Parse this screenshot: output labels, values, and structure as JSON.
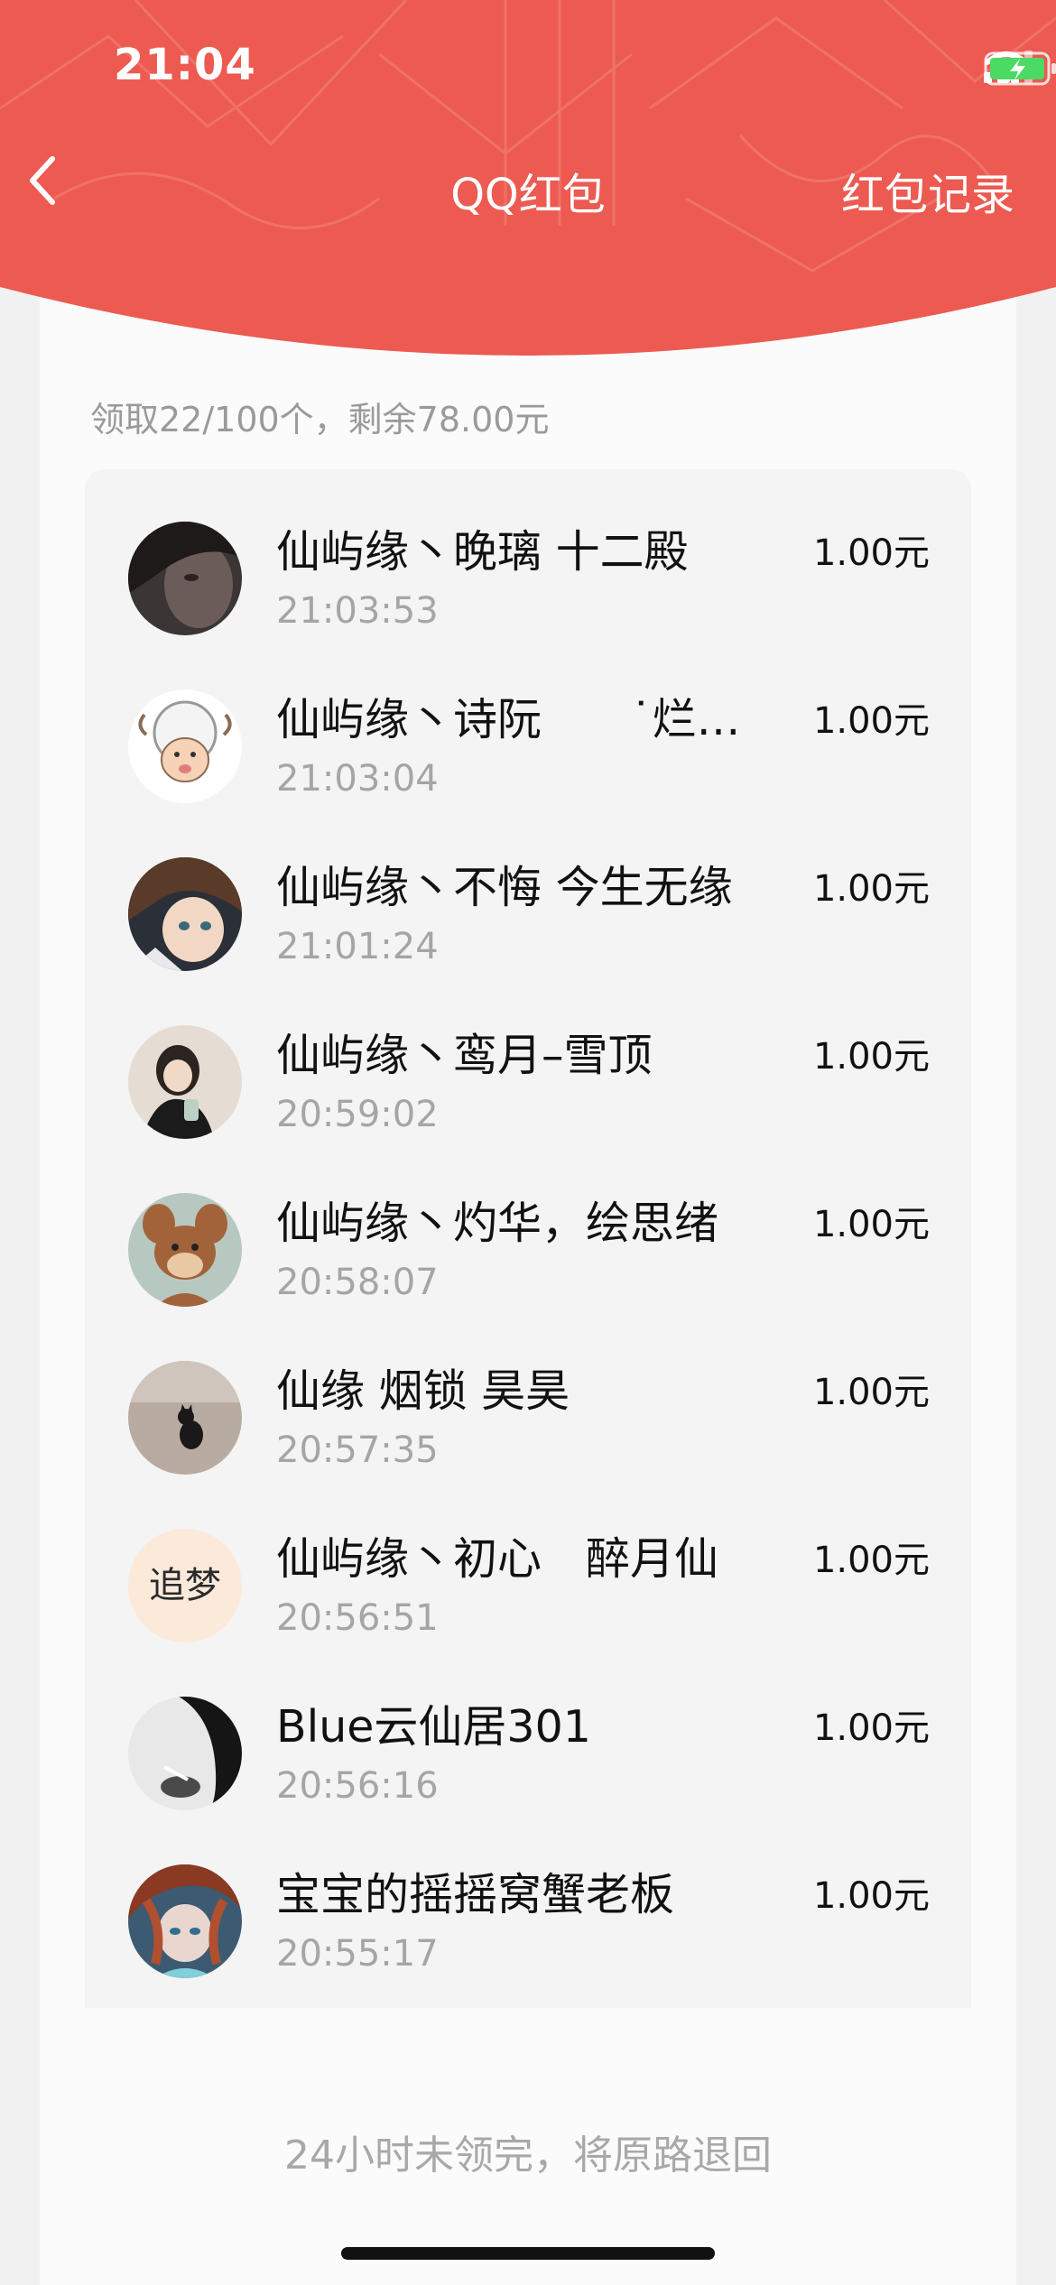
{
  "status_bar": {
    "time": "21:04"
  },
  "nav": {
    "title": "QQ红包",
    "right_label": "红包记录",
    "back_icon": "chevron-left-icon"
  },
  "summary": "领取22/100个，剩余78.00元",
  "records": [
    {
      "name": "仙屿缘丶晚璃 十二殿",
      "time": "21:03:53",
      "amount": "1.00元"
    },
    {
      "name": "仙屿缘丶诗阮　　˙烂…",
      "time": "21:03:04",
      "amount": "1.00元"
    },
    {
      "name": "仙屿缘丶不悔 今生无缘",
      "time": "21:01:24",
      "amount": "1.00元"
    },
    {
      "name": "仙屿缘丶鸾月–雪顶",
      "time": "20:59:02",
      "amount": "1.00元"
    },
    {
      "name": "仙屿缘丶灼华，绘思绪",
      "time": "20:58:07",
      "amount": "1.00元"
    },
    {
      "name": "仙缘 烟锁 昊昊",
      "time": "20:57:35",
      "amount": "1.00元"
    },
    {
      "name": "仙屿缘丶初心　醉月仙",
      "time": "20:56:51",
      "amount": "1.00元"
    },
    {
      "name": "Blue云仙居301",
      "time": "20:56:16",
      "amount": "1.00元"
    },
    {
      "name": "宝宝的摇摇窝蟹老板",
      "time": "20:55:17",
      "amount": "1.00元"
    }
  ],
  "avatar_5_text": "追梦",
  "footer_note": "24小时未领完，将原路退回",
  "colors": {
    "header_red": "#ec5a51",
    "header_pattern": "#f07a6f",
    "battery_green": "#4cd964"
  }
}
